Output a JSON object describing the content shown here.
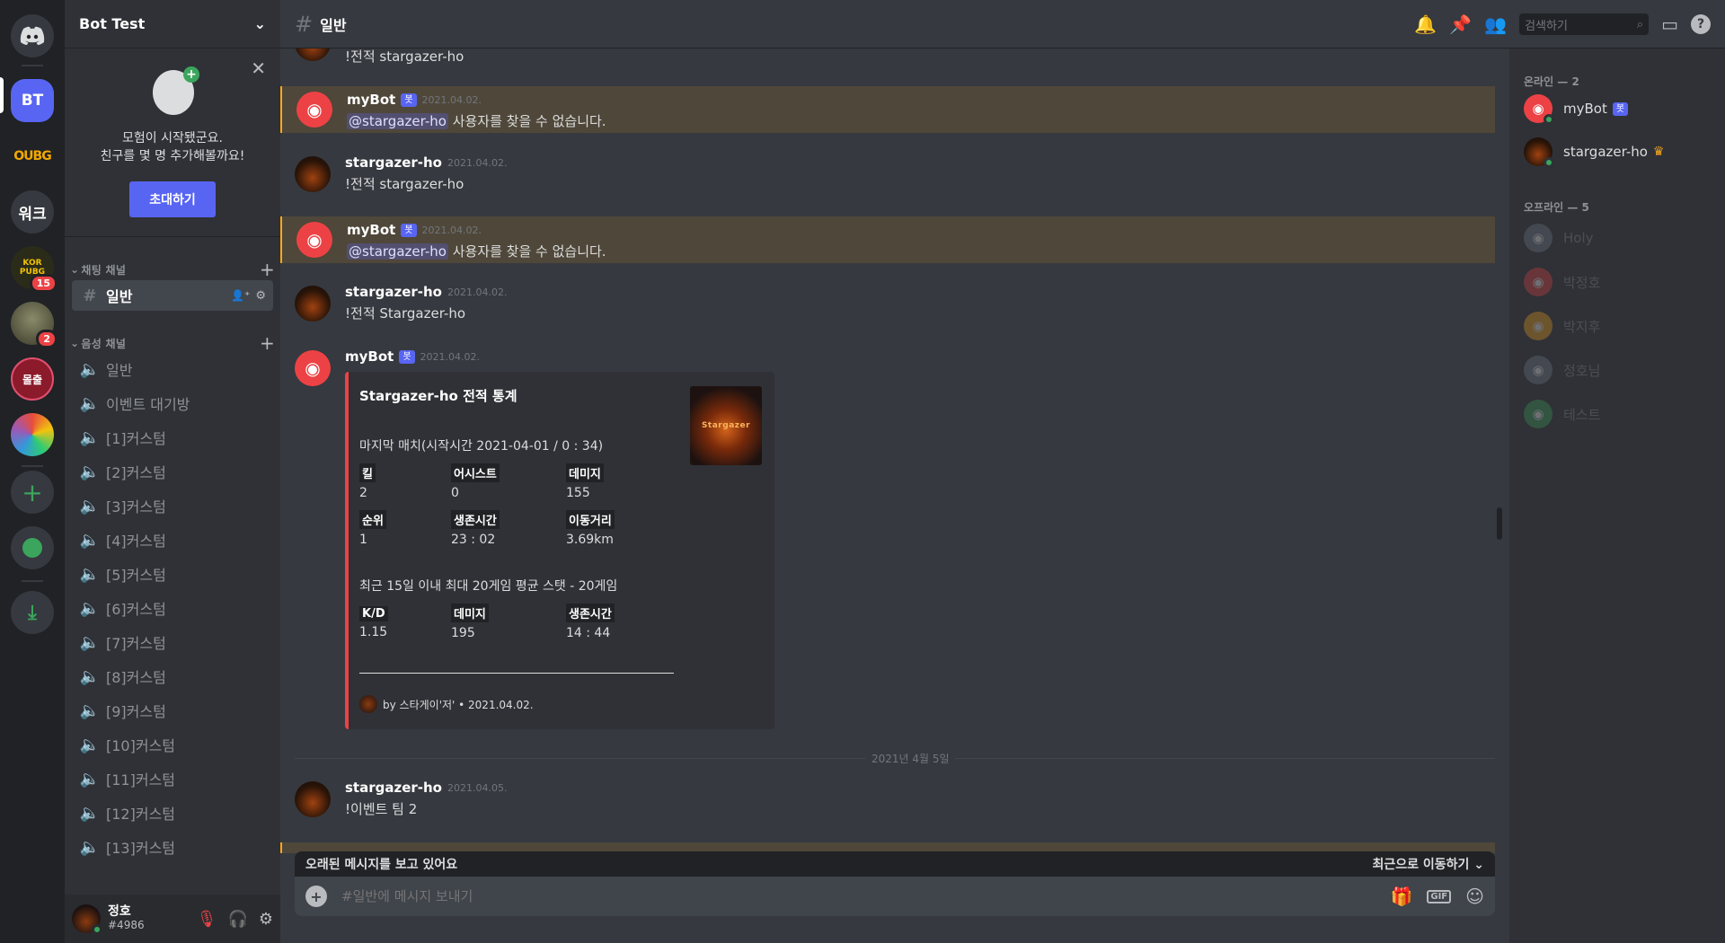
{
  "rail": {
    "servers": [
      {
        "abbr": "BT",
        "color": "#5865f2"
      },
      {
        "abbr": "OUBG",
        "color": "#202225"
      },
      {
        "abbr": "워크",
        "color": "#36393f"
      },
      {
        "abbr": "KOR PUBG",
        "color": "#2b2b1a",
        "badge": "15"
      },
      {
        "abbr": "",
        "color": "#4a4a3a",
        "badge": "2"
      },
      {
        "abbr": "몰출",
        "color": "#8b1a2a"
      },
      {
        "abbr": "",
        "color": "#3a5a9a"
      }
    ]
  },
  "guild": {
    "name": "Bot Test"
  },
  "invite": {
    "line1": "모험이 시작됐군요.",
    "line2": "친구를 몇 명 추가해볼까요!",
    "button": "초대하기"
  },
  "categories": {
    "text": "채팅 채널",
    "voice": "음성 채널"
  },
  "text_channels": [
    "일반"
  ],
  "voice_channels": [
    "일반",
    "이벤트 대기방",
    "[1]커스텀",
    "[2]커스텀",
    "[3]커스텀",
    "[4]커스텀",
    "[5]커스텀",
    "[6]커스텀",
    "[7]커스텀",
    "[8]커스텀",
    "[9]커스텀",
    "[10]커스텀",
    "[11]커스텀",
    "[12]커스텀",
    "[13]커스텀"
  ],
  "user": {
    "name": "정호",
    "tag": "#4986"
  },
  "topbar": {
    "channel": "일반",
    "search_placeholder": "검색하기"
  },
  "messages": [
    {
      "author": "",
      "time": "",
      "text": "!전적 stargazer-ho"
    },
    {
      "author": "myBot",
      "bot": "봇",
      "time": "2021.04.02.",
      "mention": "@stargazer-ho",
      "text": "사용자를 찾을 수 없습니다."
    },
    {
      "author": "stargazer-ho",
      "time": "2021.04.02.",
      "text": "!전적 stargazer-ho"
    },
    {
      "author": "myBot",
      "bot": "봇",
      "time": "2021.04.02.",
      "mention": "@stargazer-ho",
      "text": "사용자를 찾을 수 없습니다."
    },
    {
      "author": "stargazer-ho",
      "time": "2021.04.02.",
      "text": "!전적 Stargazer-ho"
    },
    {
      "author": "myBot",
      "bot": "봇",
      "time": "2021.04.02."
    },
    {
      "author": "stargazer-ho",
      "time": "2021.04.05.",
      "text": "!이벤트 팀 2"
    }
  ],
  "embed": {
    "title": "Stargazer-ho 전적 통계",
    "thumb_text": "Stargazer",
    "last_match": "마지막 매치(시작시간 2021-04-01 / 0 : 34)",
    "fields1": [
      {
        "name": "킬",
        "value": "2"
      },
      {
        "name": "어시스트",
        "value": "0"
      },
      {
        "name": "데미지",
        "value": "155"
      },
      {
        "name": "순위",
        "value": "1"
      },
      {
        "name": "생존시간",
        "value": "23 : 02"
      },
      {
        "name": "이동거리",
        "value": "3.69km"
      }
    ],
    "recent": "최근 15일 이내 최대 20게임 평균 스탯 - 20게임",
    "fields2": [
      {
        "name": "K/D",
        "value": "1.15"
      },
      {
        "name": "데미지",
        "value": "195"
      },
      {
        "name": "생존시간",
        "value": "14 : 44"
      }
    ],
    "footer": "by 스타게이'저' • 2021.04.02."
  },
  "divider": "2021년 4월 5일",
  "old_bar": {
    "text": "오래된 메시지를 보고 있어요",
    "jump": "최근으로 이동하기"
  },
  "composer": {
    "placeholder": "#일반에 메시지 보내기",
    "gif": "GIF"
  },
  "members": {
    "online_header": "온라인 — 2",
    "offline_header": "오프라인 — 5",
    "online": [
      {
        "name": "myBot",
        "bot": "봇",
        "color": "#ed4245"
      },
      {
        "name": "stargazer-ho",
        "crown": "♛"
      }
    ],
    "offline": [
      {
        "name": "Holy",
        "color": "#747f8d"
      },
      {
        "name": "박정호",
        "color": "#ed4245"
      },
      {
        "name": "박지후",
        "color": "#faa61a"
      },
      {
        "name": "정호님",
        "color": "#747f8d"
      },
      {
        "name": "테스트",
        "color": "#3ba55d"
      }
    ]
  }
}
